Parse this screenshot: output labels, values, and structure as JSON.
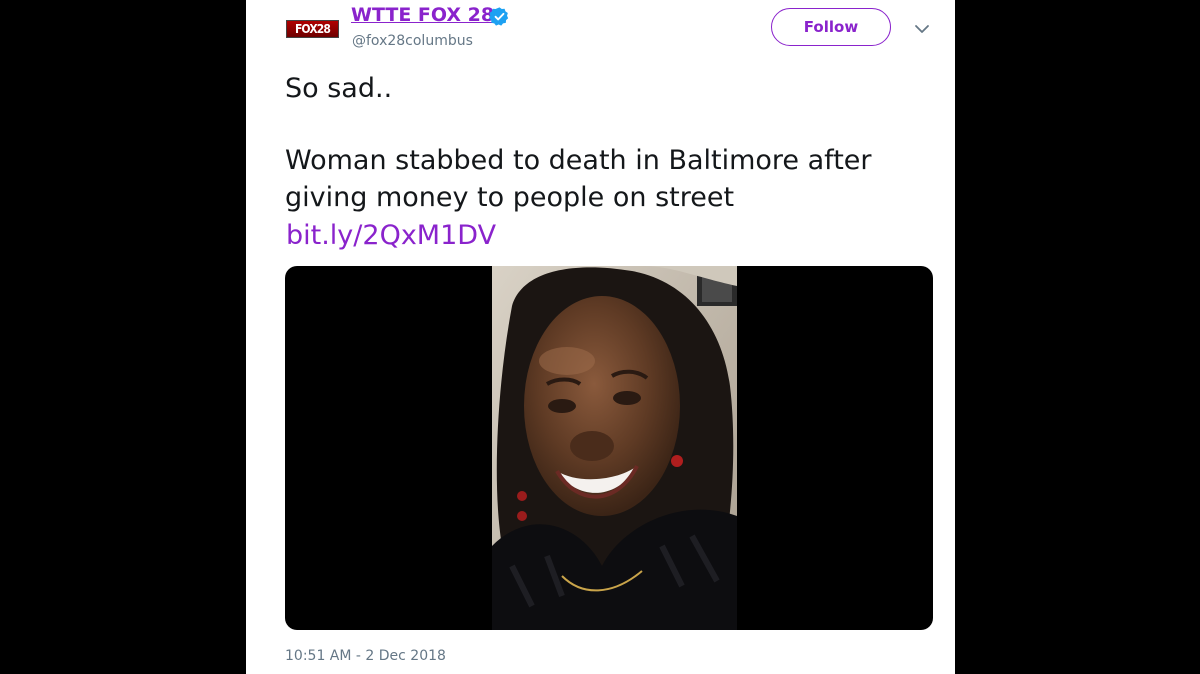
{
  "account": {
    "logo_text": "FOX28",
    "display_name": "WTTE FOX 28",
    "handle": "@fox28columbus",
    "verified_icon": "verified-badge-icon"
  },
  "actions": {
    "follow_label": "Follow",
    "more_icon": "chevron-down-icon"
  },
  "tweet": {
    "line_1": "So sad..",
    "line_2": "Woman stabbed to death in Baltimore after",
    "line_3": "giving money to people on street",
    "link": "bit.ly/2QxM1DV",
    "timestamp": "10:51 AM - 2 Dec 2018"
  },
  "colors": {
    "accent": "#8a23cc",
    "verified": "#1da1f2",
    "text": "#14171a",
    "muted": "#657786",
    "background": "#000000"
  }
}
